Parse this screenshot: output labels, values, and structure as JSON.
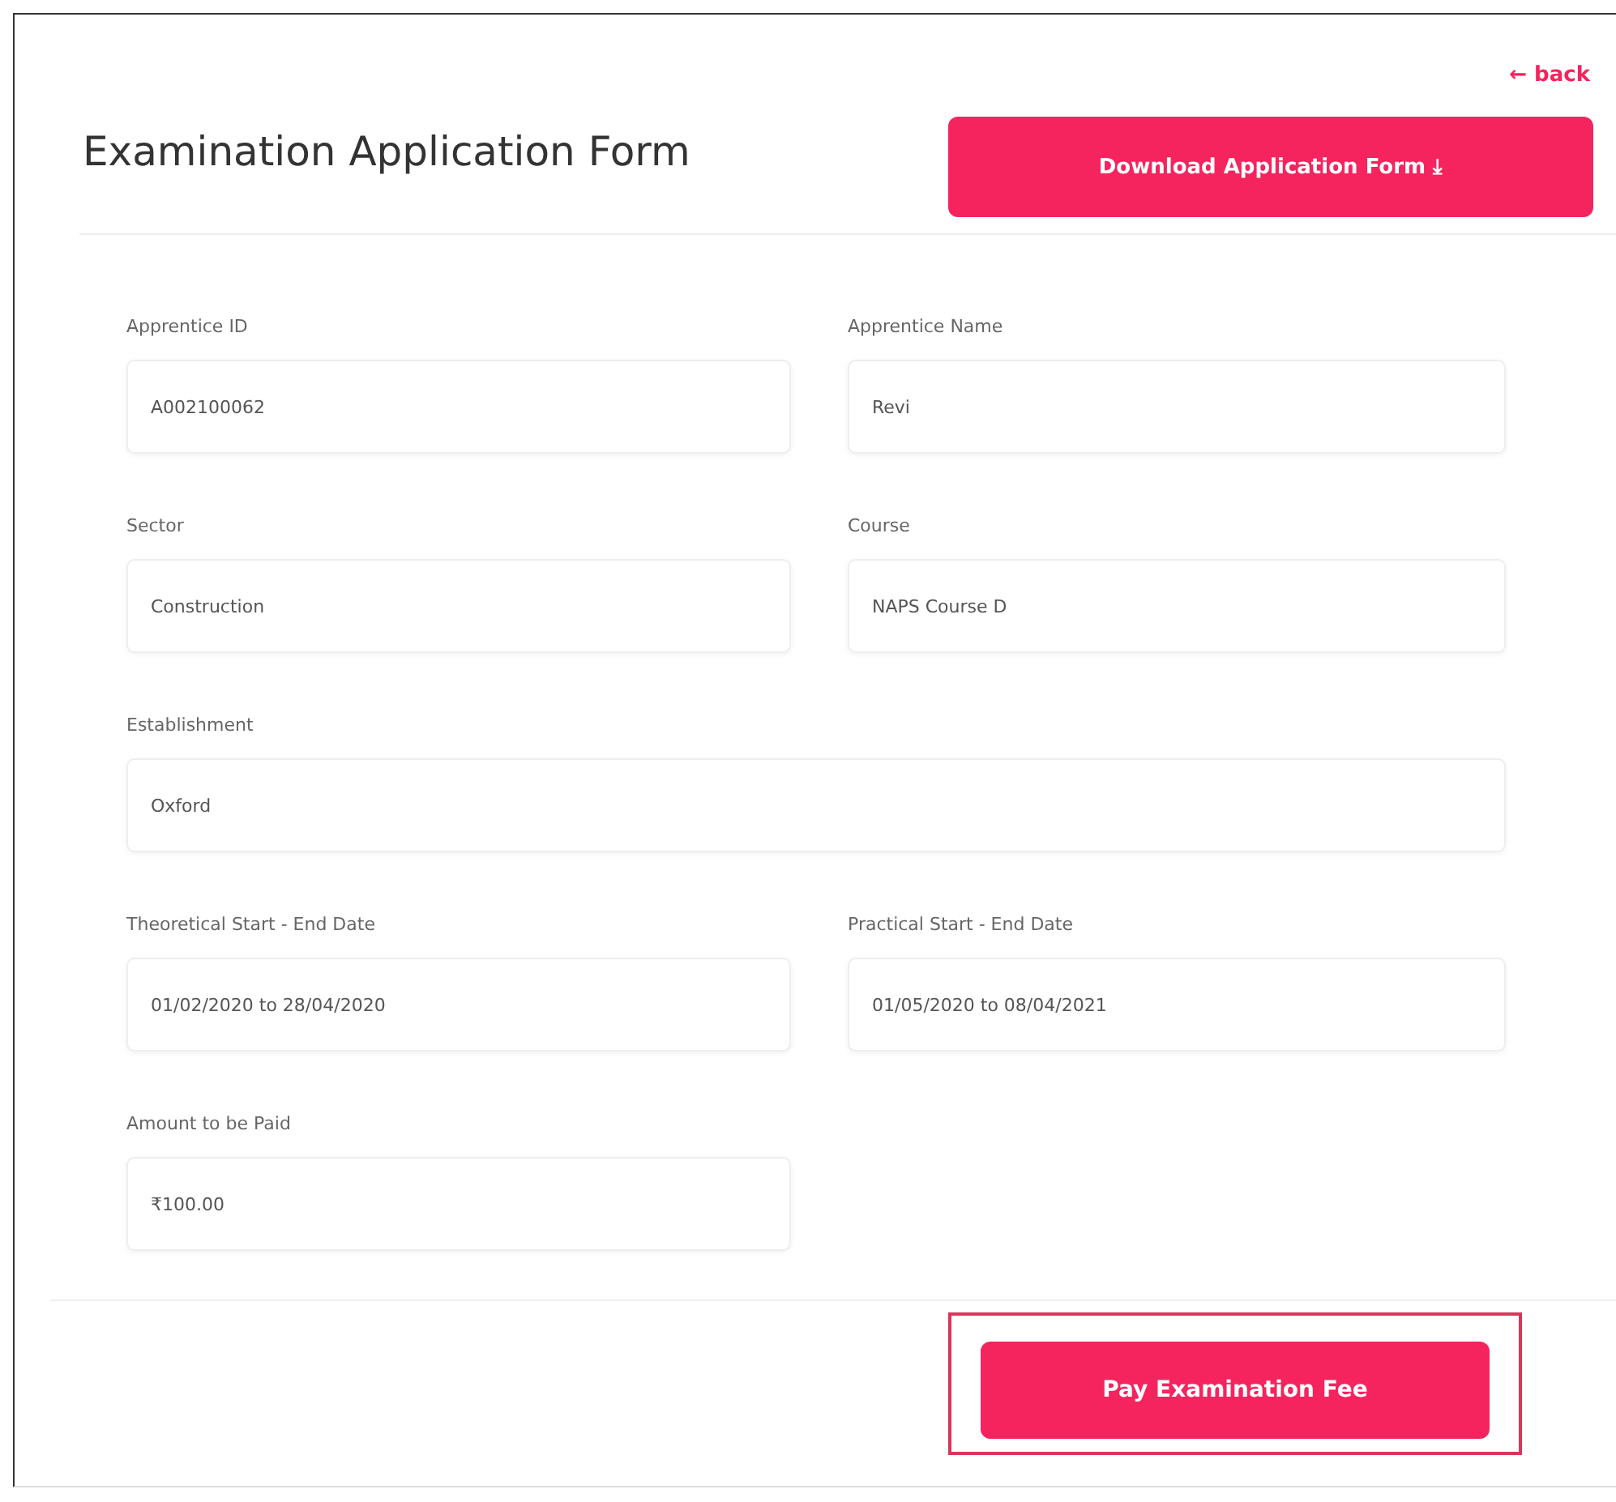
{
  "header": {
    "title": "Examination Application Form",
    "back_link": "← back",
    "download_button": "Download Application Form ⤓"
  },
  "fields": [
    {
      "label": "Apprentice ID",
      "value": "A002100062",
      "wide": false
    },
    {
      "label": "Apprentice Name",
      "value": "Revi",
      "wide": false
    },
    {
      "label": "Sector",
      "value": "Construction",
      "wide": false
    },
    {
      "label": "Course",
      "value": "NAPS Course D",
      "wide": false
    },
    {
      "label": "Establishment",
      "value": "Oxford",
      "wide": true
    },
    {
      "label": "Theoretical Start - End Date",
      "value": "01/02/2020 to 28/04/2020",
      "wide": false
    },
    {
      "label": "Practical Start - End Date",
      "value": "01/05/2020 to 08/04/2021",
      "wide": false
    },
    {
      "label": "Amount to be Paid",
      "value": "₹100.00",
      "wide": false
    }
  ],
  "pay_button": {
    "label": "Pay Examination Fee",
    "highlighted": true
  }
}
